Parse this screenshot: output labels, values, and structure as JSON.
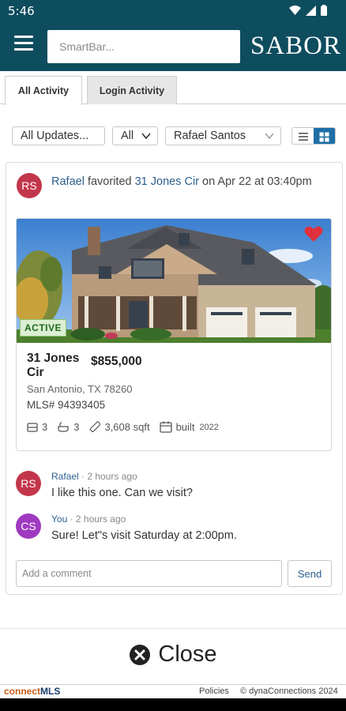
{
  "status_bar": {
    "time": "5:46"
  },
  "header": {
    "smartbar_placeholder": "SmartBar...",
    "brand": "SABOR"
  },
  "tabs": [
    {
      "label": "All Activity"
    },
    {
      "label": "Login Activity"
    }
  ],
  "filters": {
    "updates": "All Updates...",
    "scope": "All",
    "person": "Rafael Santos"
  },
  "activity": {
    "avatar": "RS",
    "actor": "Rafael",
    "verb": "favorited",
    "property_link": "31 Jones Cir",
    "when": "on Apr 22 at 03:40pm"
  },
  "listing": {
    "status": "ACTIVE",
    "address": "31 Jones Cir",
    "price": "$855,000",
    "city": "San Antonio, TX 78260",
    "mls": "MLS# 94393405",
    "beds": "3",
    "baths": "3",
    "sqft": "3,608 sqft",
    "built_label": "built",
    "built_year": "2022"
  },
  "comments": [
    {
      "avatar": "RS",
      "author": "Rafael",
      "time": "2 hours ago",
      "text": "I like this one. Can we visit?"
    },
    {
      "avatar": "CS",
      "author": "You",
      "time": "2 hours ago",
      "text": "Sure! Let\"s visit Saturday at 2:00pm."
    }
  ],
  "comment_box": {
    "placeholder": "Add a comment",
    "send_label": "Send"
  },
  "close_label": "Close",
  "footer": {
    "brand_part1": "connect",
    "brand_part2": "MLS",
    "policies": "Policies",
    "copyright": "© dynaConnections 2024"
  },
  "colors": {
    "header_bg": "#0e4d5e",
    "link": "#2c5f8f",
    "active_badge": "#dcefd2",
    "heart": "#e0303c",
    "toggle_active": "#1d6fa6"
  }
}
